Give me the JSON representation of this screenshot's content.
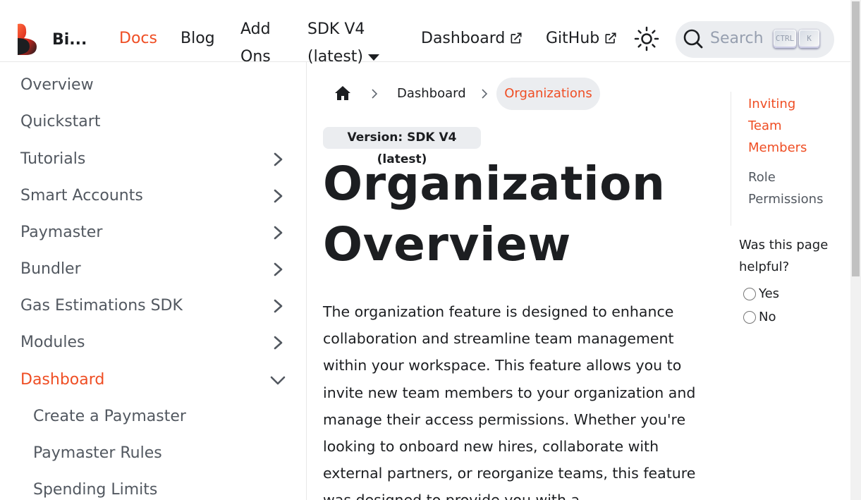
{
  "navbar": {
    "brand": "Bi...",
    "links": {
      "docs": "Docs",
      "blog": "Blog",
      "addons": "Add Ons",
      "sdk_version": "SDK V4 (latest)",
      "dashboard": "Dashboard",
      "github": "GitHub"
    },
    "search": {
      "placeholder": "Search",
      "kbd_ctrl": "CTRL",
      "kbd_k": "K"
    },
    "accent_color": "#ef4e24"
  },
  "sidebar": {
    "items": [
      {
        "label": "Overview"
      },
      {
        "label": "Quickstart"
      },
      {
        "label": "Tutorials"
      },
      {
        "label": "Smart Accounts"
      },
      {
        "label": "Paymaster"
      },
      {
        "label": "Bundler"
      },
      {
        "label": "Gas Estimations SDK"
      },
      {
        "label": "Modules"
      },
      {
        "label": "Dashboard"
      }
    ],
    "sub_items": [
      {
        "label": "Create a Paymaster"
      },
      {
        "label": "Paymaster Rules"
      },
      {
        "label": "Spending Limits"
      }
    ]
  },
  "breadcrumbs": {
    "home_icon": "home-icon",
    "dashboard": "Dashboard",
    "current": "Organizations"
  },
  "main": {
    "version_badge": "Version: SDK V4 (latest)",
    "title": "Organization Overview",
    "intro": "The organization feature is designed to enhance collaboration and streamline team management within your workspace. This feature allows you to invite new team members to your organization and manage their access permissions. Whether you're looking to onboard new hires, collaborate with external partners, or reorganize teams, this feature was designed to provide you with a"
  },
  "toc": {
    "items": [
      {
        "label": "Inviting Team Members"
      },
      {
        "label": "Role Permissions"
      }
    ]
  },
  "feedback": {
    "question": "Was this page helpful?",
    "yes": "Yes",
    "no": "No"
  }
}
